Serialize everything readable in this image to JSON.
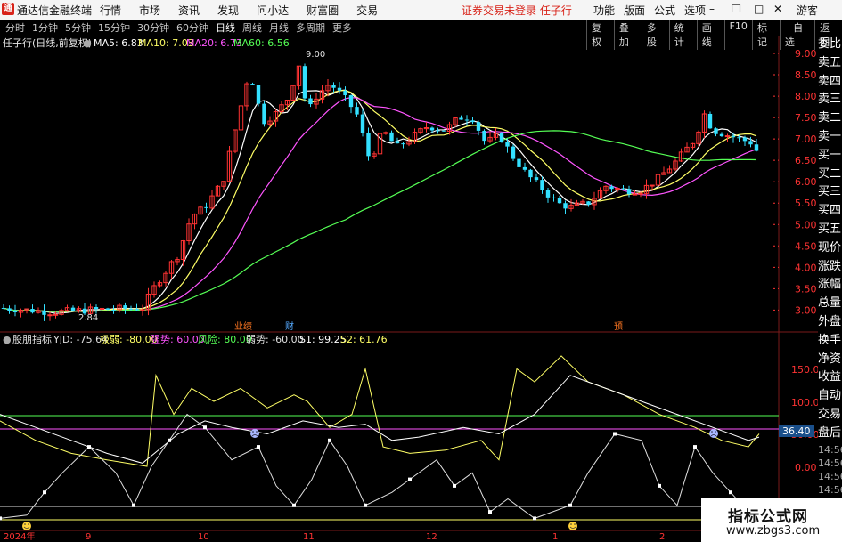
{
  "app": {
    "logo": "通",
    "title": "通达信金融终端",
    "menu": [
      "行情",
      "市场",
      "资讯",
      "发现",
      "问小达",
      "财富圈",
      "交易"
    ],
    "warning": "证券交易未登录  任子行",
    "right_menu": [
      "功能",
      "版面",
      "公式",
      "选项"
    ],
    "user": "游客"
  },
  "toolbar": {
    "periods": [
      "分时",
      "1分钟",
      "5分钟",
      "15分钟",
      "30分钟",
      "60分钟",
      "日线",
      "周线",
      "月线",
      "多周期",
      "更多"
    ],
    "active_period": "日线",
    "tools": [
      "复权",
      "叠加",
      "多股",
      "统计",
      "画线",
      "F10",
      "标记",
      "+自选",
      "返回"
    ]
  },
  "main_chart": {
    "stock_label": "任子行(日线,前复权)",
    "ma_legend": [
      {
        "label": "MA5: 6.83",
        "color": "#ffffff"
      },
      {
        "label": "MA10: 7.03",
        "color": "#ffff66"
      },
      {
        "label": "MA20: 6.73",
        "color": "#ff55ff"
      },
      {
        "label": "MA60: 6.56",
        "color": "#55ff55"
      }
    ],
    "y_ticks": [
      "9.00",
      "8.50",
      "8.00",
      "7.50",
      "7.00",
      "6.50",
      "6.00",
      "5.50",
      "5.00",
      "4.50",
      "4.00",
      "3.50",
      "3.00"
    ],
    "ylim": [
      2.8,
      9.25
    ],
    "high_label": "9.00",
    "low_label": "2.84",
    "event_markers": [
      "业绩",
      "财",
      "预"
    ]
  },
  "indicator": {
    "legend": [
      {
        "label": "股朋指标",
        "color": "#e0e0e0"
      },
      {
        "label": "YJD: -75.64",
        "color": "#e0e0e0"
      },
      {
        "label": "极弱: -80.00",
        "color": "#ffff66"
      },
      {
        "label": "强势: 60.00",
        "color": "#ff55ff"
      },
      {
        "label": "风险: 80.00",
        "color": "#55ff55"
      },
      {
        "label": "弱势: -60.00",
        "color": "#e0e0e0"
      },
      {
        "label": "S1: 99.25",
        "color": "#ffffff"
      },
      {
        "label": "S2: 61.76",
        "color": "#ffff66"
      }
    ],
    "y_ticks": [
      "150.0",
      "100.0",
      "50.00",
      "0.00"
    ],
    "current_value": "36.40"
  },
  "x_axis": {
    "labels": [
      "2024年",
      "9",
      "10",
      "11",
      "12",
      "1",
      "2"
    ]
  },
  "sidebar": {
    "items": [
      "委比",
      "卖五",
      "卖四",
      "卖三",
      "卖二",
      "卖一",
      "买一",
      "买二",
      "买三",
      "买四",
      "买五",
      "现价",
      "涨跌",
      "涨幅",
      "总量",
      "外盘",
      "换手",
      "净资",
      "收益",
      "自动",
      "交易",
      "盘后",
      "14:56",
      "14:56",
      "14:56",
      "14:56",
      "14:56",
      "14:56",
      "14:56"
    ]
  },
  "colors": {
    "up": "#ff3333",
    "down": "#33e0ff",
    "grid": "#7a1a1a",
    "ma5": "#ffffff",
    "ma10": "#ffff66",
    "ma20": "#ff55ff",
    "ma60": "#55ff55"
  },
  "watermark": {
    "title": "指标公式网",
    "url": "www.zbgs3.com"
  }
}
